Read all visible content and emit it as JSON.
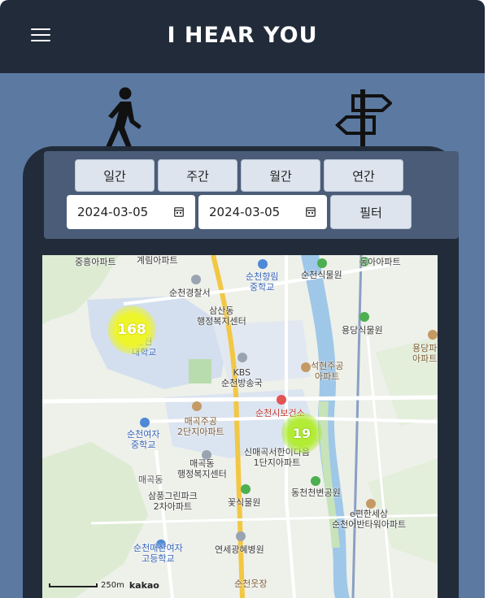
{
  "header": {
    "title": "I HEAR YOU",
    "menu_icon": "hamburger-menu-icon"
  },
  "illustrations": {
    "left": "walking-person-icon",
    "right": "signpost-icon"
  },
  "period_tabs": [
    "일간",
    "주간",
    "월간",
    "연간"
  ],
  "date_filter": {
    "start": "2024-03-05",
    "end": "2024-03-05",
    "filter_label": "필터"
  },
  "map": {
    "labels": {
      "l1": "중흥아파트",
      "l2": "계림아파트",
      "l3": "순천향림\n중학교",
      "l4": "순천식물원",
      "l5": "동아아파트",
      "l6": "순천경찰서",
      "l7": "삼산동\n행정복지센터",
      "l8": "용당식물원",
      "l9": "용당파\n아파트",
      "l10": "순천\n대학교",
      "l11": "KBS\n순천방송국",
      "l12": "석현주공\n아파트",
      "l13": "순천시보건소",
      "l14": "매곡주공\n2단지아파트",
      "l15": "순천여자\n중학교",
      "l16": "신매곡서한이다음\n1단지아파트",
      "l17": "매곡동\n행정복지센터",
      "l18": "매곡동",
      "l19": "삼풍그린파크\n2차아파트",
      "l20": "꽃식물원",
      "l21": "동천천변공원",
      "l22": "e편한세상\n순천어반타워아파트",
      "l23": "순천매산여자\n고등학교",
      "l24": "연세광혜병원",
      "l25": "순천웃장"
    },
    "clusters": [
      {
        "count": "168",
        "color": "#e8f21a"
      },
      {
        "count": "19",
        "color": "#a6e82a"
      }
    ],
    "scale_label": "250m",
    "provider": "kakao"
  }
}
